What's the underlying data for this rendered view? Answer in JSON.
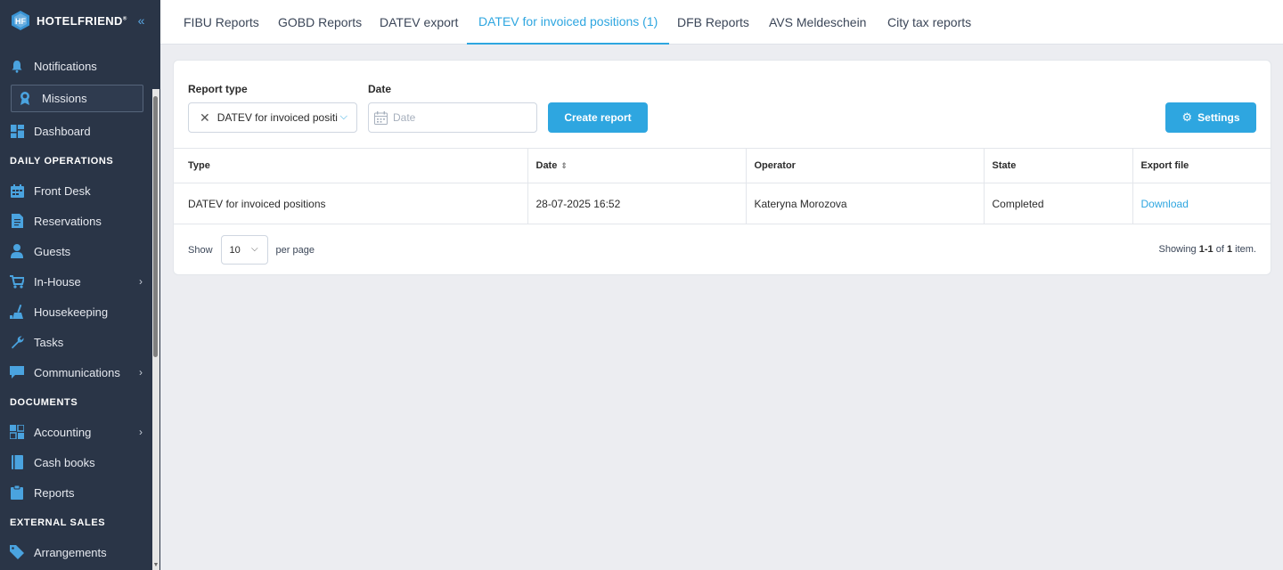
{
  "brand": {
    "name": "HOTELFRIEND",
    "reg": "®"
  },
  "sidebar": {
    "items": [
      {
        "label": "Notifications",
        "icon": "bell-icon"
      },
      {
        "label": "Missions",
        "icon": "award-icon"
      },
      {
        "label": "Dashboard",
        "icon": "dashboard-icon"
      },
      {
        "section": "DAILY OPERATIONS"
      },
      {
        "label": "Front Desk",
        "icon": "calendar-icon"
      },
      {
        "label": "Reservations",
        "icon": "document-icon"
      },
      {
        "label": "Guests",
        "icon": "person-icon"
      },
      {
        "label": "In-House",
        "icon": "cart-icon",
        "chevron": "›"
      },
      {
        "label": "Housekeeping",
        "icon": "broom-icon"
      },
      {
        "label": "Tasks",
        "icon": "wrench-icon"
      },
      {
        "label": "Communications",
        "icon": "chat-icon",
        "chevron": "›"
      },
      {
        "section": "DOCUMENTS"
      },
      {
        "label": "Accounting",
        "icon": "grid-icon",
        "chevron": "›"
      },
      {
        "label": "Cash books",
        "icon": "book-icon"
      },
      {
        "label": "Reports",
        "icon": "clipboard-icon"
      },
      {
        "section": "EXTERNAL SALES"
      },
      {
        "label": "Arrangements",
        "icon": "tag-icon"
      }
    ]
  },
  "tabs": [
    "FIBU Reports",
    "GOBD Reports",
    "DATEV export",
    "DATEV for invoiced positions (1)",
    "DFB Reports",
    "AVS Meldeschein",
    "City tax reports"
  ],
  "form": {
    "report_type_label": "Report type",
    "report_type_value": "DATEV for invoiced positions",
    "clear_glyph": "✕",
    "date_label": "Date",
    "date_placeholder": "Date",
    "create_label": "Create report",
    "settings_label": "Settings"
  },
  "table": {
    "headers": [
      "Type",
      "Date",
      "Operator",
      "State",
      "Export file"
    ],
    "rows": [
      [
        "DATEV for invoiced positions",
        "28-07-2025 16:52",
        "Kateryna Morozova",
        "Completed",
        "Download"
      ]
    ]
  },
  "pager": {
    "show_label": "Show",
    "per_page_value": "10",
    "per_page_label": "per page",
    "showing_prefix": "Showing",
    "showing_range": "1-1",
    "showing_of": "of",
    "showing_total": "1",
    "showing_suffix": "item."
  },
  "colors": {
    "sidebar_bg": "#2a3547",
    "accent": "#2ea6e0",
    "page_bg": "#ecedf1"
  }
}
